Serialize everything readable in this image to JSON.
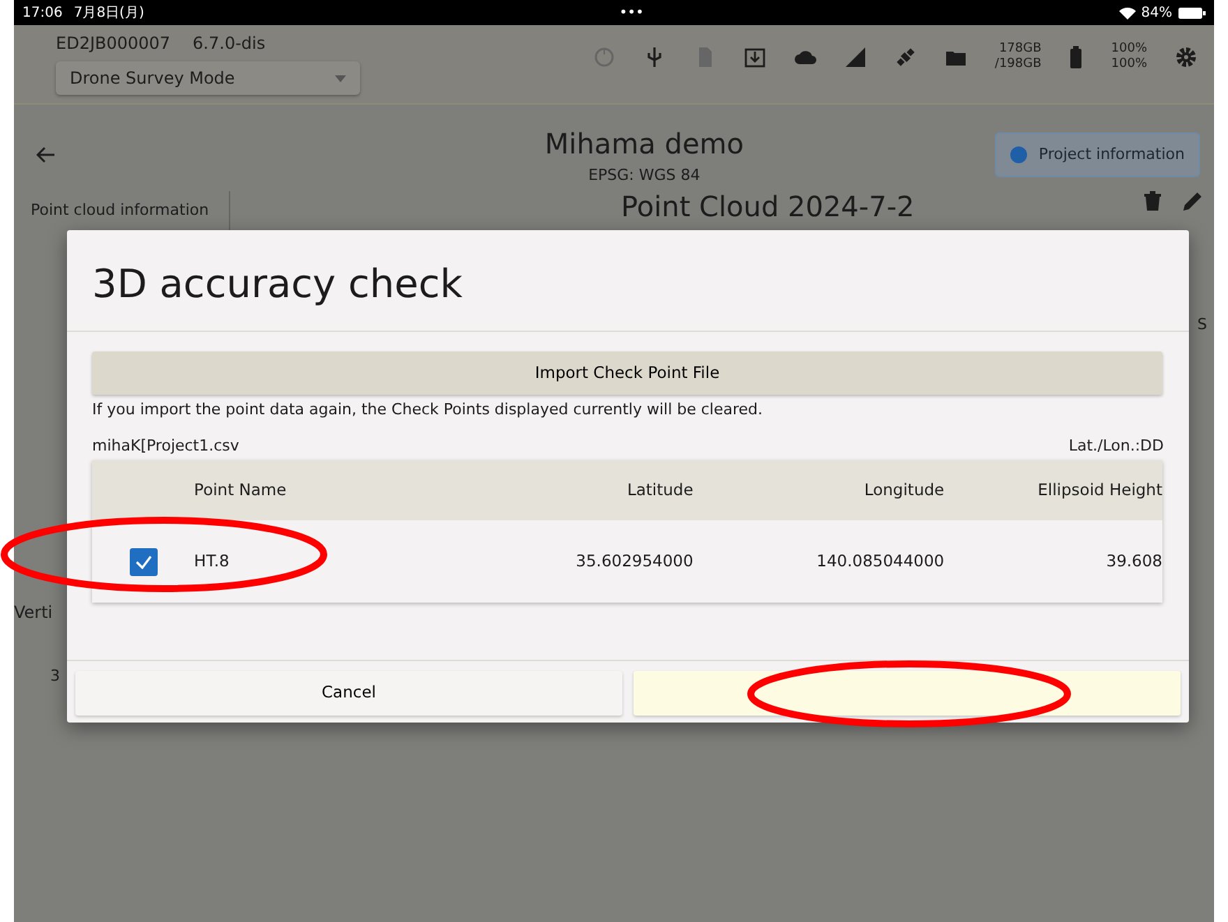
{
  "status_bar": {
    "time": "17:06",
    "date": "7月8日(月)",
    "dots": "•••",
    "battery": "84%"
  },
  "header": {
    "device_id": "ED2JB000007",
    "version": "6.7.0-dis",
    "mode": "Drone Survey Mode",
    "storage": [
      "178GB",
      "/198GB"
    ],
    "battery_levels": [
      "100%",
      "100%"
    ]
  },
  "project": {
    "title": "Mihama demo",
    "subtitle": "EPSG: WGS 84",
    "info_button": "Project information"
  },
  "background": {
    "side_tab": "Point cloud information",
    "heading": "Point Cloud 2024-7-2",
    "fragments": [
      "S",
      "Verti",
      "3"
    ]
  },
  "dialog": {
    "title": "3D accuracy check",
    "import_button": "Import Check Point File",
    "hint": "If you import the point data again, the Check Points displayed currently will be cleared.",
    "file_name": "mihaK[Project1.csv",
    "format": "Lat./Lon.:DD",
    "columns": [
      "Point Name",
      "Latitude",
      "Longitude",
      "Ellipsoid Height"
    ],
    "rows": [
      {
        "checked": true,
        "cells": [
          "HT.8",
          "35.602954000",
          "140.085044000",
          "39.608"
        ]
      }
    ],
    "buttons": [
      {
        "kind": "cancel",
        "label": "Cancel"
      },
      {
        "kind": "confirm"
      }
    ]
  },
  "annotations": [
    {
      "kind": "ellipse",
      "color": "#ff0000"
    },
    {
      "kind": "ellipse",
      "color": "#ff0000"
    }
  ]
}
